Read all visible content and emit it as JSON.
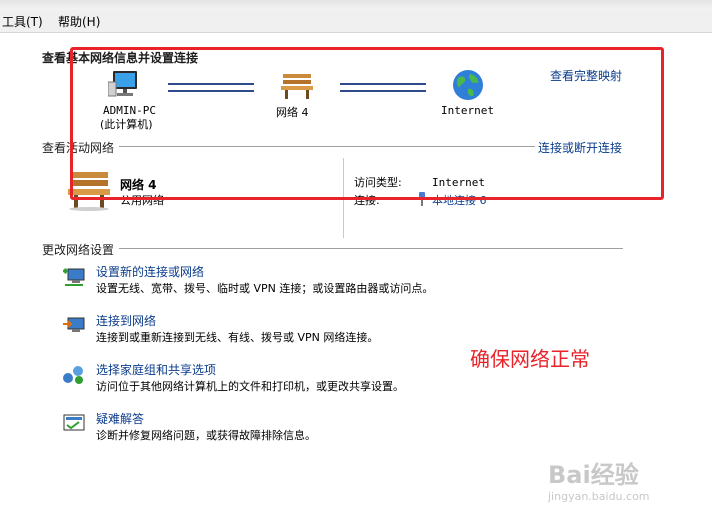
{
  "menu": {
    "tools": "工具(T)",
    "help": "帮助(H)"
  },
  "map": {
    "heading": "查看基本网络信息并设置连接",
    "full_map_link": "查看完整映射",
    "computer": {
      "name": "ADMIN-PC",
      "sub": "(此计算机)"
    },
    "network": {
      "name": "网络  4"
    },
    "internet": {
      "name": "Internet"
    }
  },
  "active": {
    "heading": "查看活动网络",
    "connect_link": "连接或断开连接",
    "network_name": "网络  4",
    "network_type": "公用网络",
    "access_label": "访问类型:",
    "access_value": "Internet",
    "conn_label": "连接:",
    "conn_value": "本地连接 6"
  },
  "settings": {
    "heading": "更改网络设置",
    "tasks": [
      {
        "title": "设置新的连接或网络",
        "desc": "设置无线、宽带、拨号、临时或 VPN 连接；或设置路由器或访问点。"
      },
      {
        "title": "连接到网络",
        "desc": "连接到或重新连接到无线、有线、拨号或 VPN 网络连接。"
      },
      {
        "title": "选择家庭组和共享选项",
        "desc": "访问位于其他网络计算机上的文件和打印机，或更改共享设置。"
      },
      {
        "title": "疑难解答",
        "desc": "诊断并修复网络问题，或获得故障排除信息。"
      }
    ]
  },
  "annotation": "确保网络正常",
  "watermark": {
    "main": "Bai经验",
    "url": "jingyan.baidu.com"
  },
  "colors": {
    "link": "#0b3c8c",
    "highlight": "#e8232a"
  }
}
